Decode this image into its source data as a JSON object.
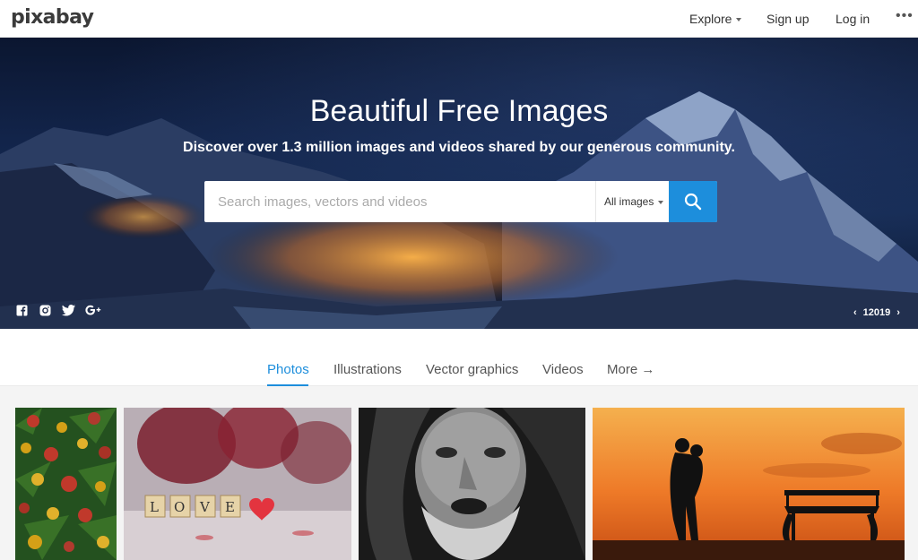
{
  "nav": {
    "logo": "pixabay",
    "explore": "Explore",
    "sign_up": "Sign up",
    "log_in": "Log in",
    "more": "•••"
  },
  "hero": {
    "title": "Beautiful Free Images",
    "subtitle": "Discover over 1.3 million images and videos shared by our generous community.",
    "search_placeholder": "Search images, vectors and videos",
    "search_type": "All images",
    "pager_label": "12019",
    "social_icons": [
      "facebook-icon",
      "instagram-icon",
      "twitter-icon",
      "google-plus-icon"
    ]
  },
  "tabs": [
    {
      "label": "Photos",
      "active": true
    },
    {
      "label": "Illustrations",
      "active": false
    },
    {
      "label": "Vector graphics",
      "active": false
    },
    {
      "label": "Videos",
      "active": false
    },
    {
      "label": "More →",
      "active": false
    }
  ],
  "colors": {
    "accent": "#1d8edc",
    "hero_bg": "#12244a"
  }
}
